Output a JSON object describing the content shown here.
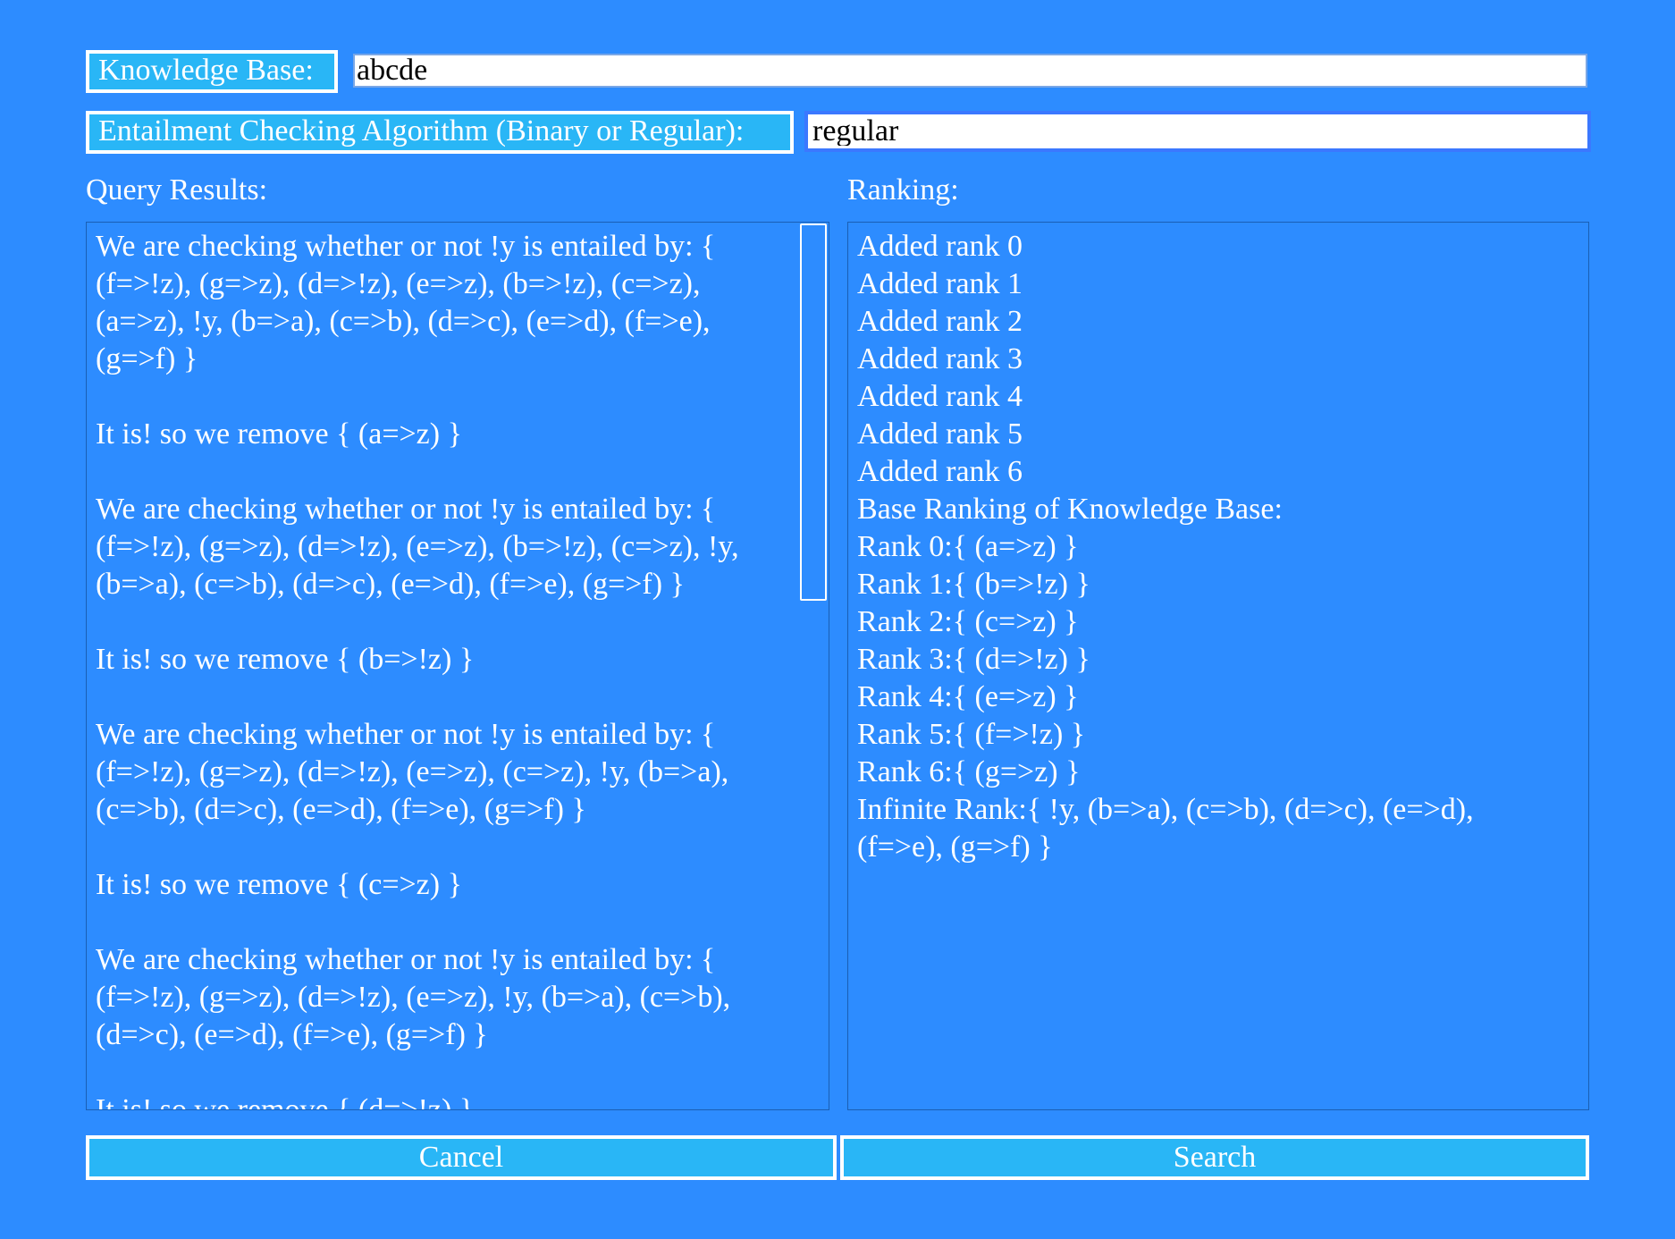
{
  "knowledge_base": {
    "label": "Knowledge Base:",
    "value": "abcde"
  },
  "algorithm": {
    "label": "Entailment Checking Algorithm (Binary or Regular):",
    "value": "regular"
  },
  "query_results": {
    "title": "Query Results:",
    "lines": [
      "We are checking whether or not !y is entailed by: {",
      "(f=>!z), (g=>z), (d=>!z), (e=>z), (b=>!z), (c=>z),",
      "(a=>z), !y, (b=>a), (c=>b), (d=>c), (e=>d), (f=>e),",
      "(g=>f) }",
      "",
      "It is! so we remove { (a=>z) }",
      "",
      "We are checking whether or not !y is entailed by: {",
      "(f=>!z), (g=>z), (d=>!z), (e=>z), (b=>!z), (c=>z), !y,",
      "(b=>a), (c=>b), (d=>c), (e=>d), (f=>e), (g=>f) }",
      "",
      "It is! so we remove { (b=>!z) }",
      "",
      "We are checking whether or not !y is entailed by: {",
      "(f=>!z), (g=>z), (d=>!z), (e=>z), (c=>z), !y, (b=>a),",
      "(c=>b), (d=>c), (e=>d), (f=>e), (g=>f) }",
      "",
      "It is! so we remove { (c=>z) }",
      "",
      "We are checking whether or not !y is entailed by: {",
      "(f=>!z), (g=>z), (d=>!z), (e=>z), !y, (b=>a), (c=>b),",
      "(d=>c), (e=>d), (f=>e), (g=>f) }",
      "",
      "It is! so we remove { (d=>!z) }"
    ]
  },
  "ranking": {
    "title": "Ranking:",
    "lines": [
      "Added rank 0",
      "Added rank 1",
      "Added rank 2",
      "Added rank 3",
      "Added rank 4",
      "Added rank 5",
      "Added rank 6",
      "Base Ranking of Knowledge Base:",
      "Rank 0:{ (a=>z) }",
      "Rank 1:{ (b=>!z) }",
      "Rank 2:{ (c=>z) }",
      "Rank 3:{ (d=>!z) }",
      "Rank 4:{ (e=>z) }",
      "Rank 5:{ (f=>!z) }",
      "Rank 6:{ (g=>z) }",
      "Infinite Rank:{ !y, (b=>a), (c=>b), (d=>c), (e=>d),",
      "(f=>e), (g=>f) }"
    ]
  },
  "buttons": {
    "cancel": "Cancel",
    "search": "Search"
  },
  "colors": {
    "background": "#2d8cff",
    "accent": "#29b6f6",
    "text": "#ffffff"
  }
}
